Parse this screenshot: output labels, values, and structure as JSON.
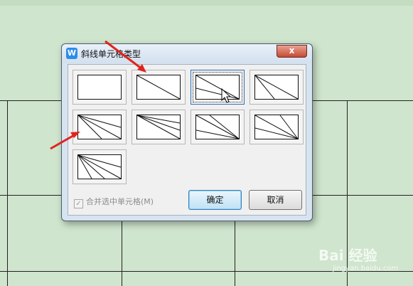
{
  "dialog": {
    "title": "斜线单元格类型",
    "app_icon": "W",
    "close_label": "x",
    "merge_checkbox_label": "合并选中单元格(M)",
    "merge_checked": true,
    "ok_label": "确定",
    "cancel_label": "取消"
  },
  "diagonal_types": [
    {
      "name": "none"
    },
    {
      "name": "single-diagonal"
    },
    {
      "name": "two-lines-from-left",
      "selected": true
    },
    {
      "name": "two-lines-from-top"
    },
    {
      "name": "three-lines-a"
    },
    {
      "name": "three-lines-b"
    },
    {
      "name": "three-lines-c"
    },
    {
      "name": "three-lines-d"
    },
    {
      "name": "four-lines"
    }
  ],
  "watermark": {
    "text": "Bai 经验",
    "sub": "jingyan.baidu.com"
  },
  "colors": {
    "sheet_bg": "#cfe5cd",
    "annotation_arrow": "#e0241d",
    "close_button": "#c64a32"
  },
  "icons": [
    "app-w-icon",
    "close-icon",
    "mouse-cursor-icon",
    "red-arrow-icon"
  ]
}
